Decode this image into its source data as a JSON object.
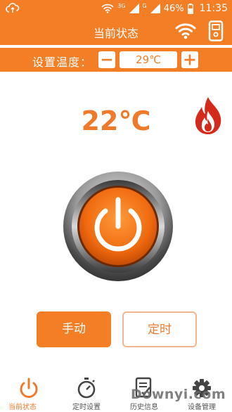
{
  "status_bar": {
    "network_3g": "3G",
    "network_g": "G",
    "battery_percent": "46%",
    "time": "11:35"
  },
  "header": {
    "title": "当前状态",
    "icons": [
      "wifi-icon",
      "device-icon"
    ]
  },
  "temp_setting": {
    "label": "设置温度：",
    "minus_label": "−",
    "plus_label": "+",
    "target_value": "29℃"
  },
  "main": {
    "current_temp": "22℃",
    "heating_icon": "flame-icon",
    "power_icon": "power-icon"
  },
  "mode_buttons": {
    "manual_label": "手动",
    "timer_label": "定时",
    "active": "manual"
  },
  "bottom_nav": {
    "items": [
      {
        "label": "当前状态",
        "icon": "power-icon",
        "active": true
      },
      {
        "label": "定时设置",
        "icon": "stopwatch-icon",
        "active": false
      },
      {
        "label": "历史信息",
        "icon": "history-icon",
        "active": false
      },
      {
        "label": "设备管理",
        "icon": "gear-icon",
        "active": false
      }
    ]
  },
  "watermark": "Downyi.com",
  "colors": {
    "accent": "#f47e26",
    "accent_text": "#ee7a2c",
    "flame": "#d42a1c"
  }
}
